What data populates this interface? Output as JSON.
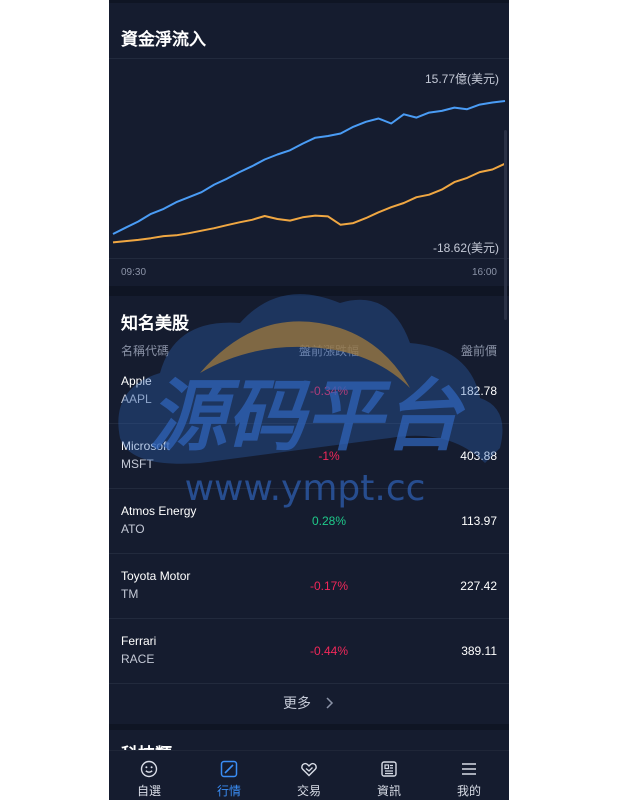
{
  "net_flow": {
    "title": "資金淨流入",
    "top_label": "15.77億(美元)",
    "bottom_label": "-18.62(美元)",
    "time_start": "09:30",
    "time_end": "16:00"
  },
  "chart_data": {
    "type": "line",
    "x_range": [
      "09:30",
      "16:00"
    ],
    "series": [
      {
        "color": "#4a9cf5",
        "values": [
          -16.0,
          -14.5,
          -13.0,
          -11.2,
          -10.0,
          -8.4,
          -7.2,
          -6.0,
          -4.2,
          -2.8,
          -1.2,
          0.2,
          1.8,
          3.0,
          4.0,
          5.6,
          7.0,
          7.4,
          8.0,
          9.6,
          10.8,
          11.6,
          10.4,
          12.6,
          11.8,
          13.0,
          13.4,
          14.2,
          13.8,
          14.9,
          15.4,
          15.77
        ]
      },
      {
        "color": "#f0a742",
        "values": [
          -18.0,
          -17.7,
          -17.4,
          -17.0,
          -16.5,
          -16.3,
          -15.8,
          -15.2,
          -14.6,
          -13.9,
          -13.2,
          -12.6,
          -11.7,
          -12.4,
          -12.8,
          -12.0,
          -11.6,
          -11.8,
          -13.8,
          -13.4,
          -12.2,
          -10.8,
          -9.6,
          -8.6,
          -7.2,
          -6.6,
          -5.4,
          -3.6,
          -2.6,
          -1.2,
          -0.6,
          0.8
        ]
      }
    ]
  },
  "us_stocks": {
    "title": "知名美股",
    "col_name": "名稱代碼",
    "col_change": "盤前漲跌幅",
    "col_price": "盤前價",
    "rows": [
      {
        "name": "Apple",
        "code": "AAPL",
        "change": "-0.34%",
        "price": "182.78",
        "dir": "neg"
      },
      {
        "name": "Microsoft",
        "code": "MSFT",
        "change": "-1%",
        "price": "403.88",
        "dir": "neg"
      },
      {
        "name": "Atmos Energy",
        "code": "ATO",
        "change": "0.28%",
        "price": "113.97",
        "dir": "pos"
      },
      {
        "name": "Toyota Motor",
        "code": "TM",
        "change": "-0.17%",
        "price": "227.42",
        "dir": "neg"
      },
      {
        "name": "Ferrari",
        "code": "RACE",
        "change": "-0.44%",
        "price": "389.11",
        "dir": "neg"
      }
    ],
    "more": "更多"
  },
  "next_section": {
    "title": "科技類"
  },
  "watermark": {
    "text_cn": "源码平台",
    "text_url": "www.ympt.cc"
  },
  "tabbar": {
    "items": [
      {
        "label": "自選",
        "icon": "smile-icon"
      },
      {
        "label": "行情",
        "icon": "chart-icon",
        "active": true
      },
      {
        "label": "交易",
        "icon": "handshake-icon"
      },
      {
        "label": "資訊",
        "icon": "news-icon"
      },
      {
        "label": "我的",
        "icon": "menu-icon"
      }
    ]
  }
}
